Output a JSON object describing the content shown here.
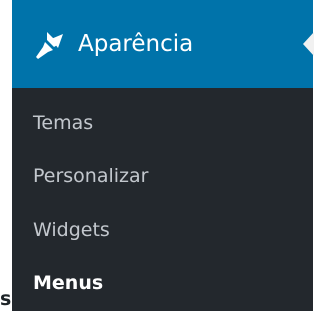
{
  "appearance_menu": {
    "title": "Aparência",
    "icon": "paintbrush-icon",
    "submenu": [
      {
        "label": "Temas"
      },
      {
        "label": "Personalizar"
      },
      {
        "label": "Widgets"
      },
      {
        "label": "Menus",
        "current": true
      }
    ]
  },
  "stray_text": "s",
  "colors": {
    "header": "#0073aa",
    "menu_bg": "#23282d",
    "text_current": "#ffffff"
  }
}
